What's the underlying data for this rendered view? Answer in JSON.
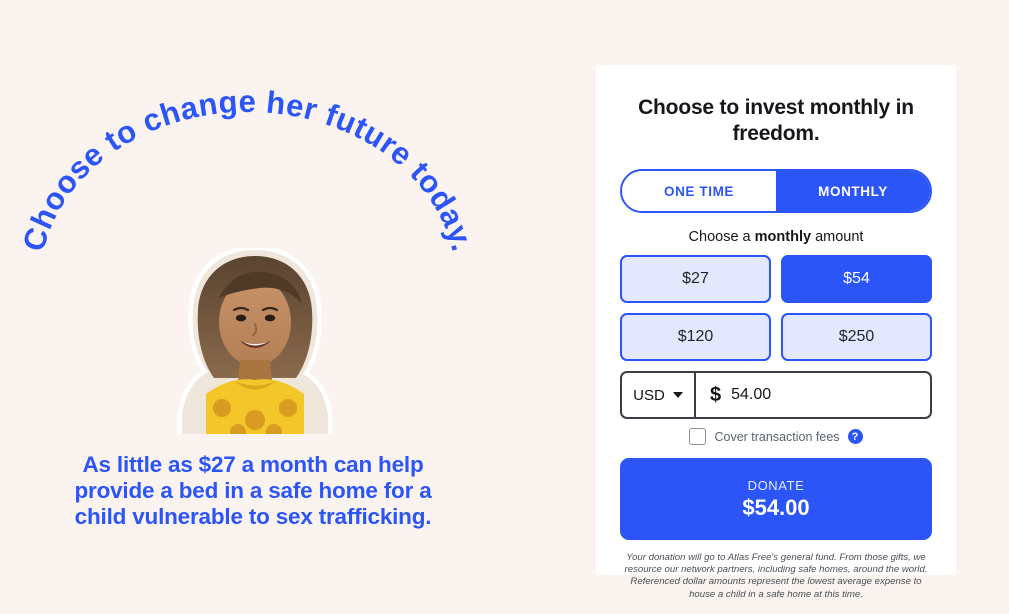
{
  "colors": {
    "page_background": "#faf3ef",
    "card_background": "#ffffff",
    "accent_blue": "#2b55f7",
    "light_blue": "#e3e8fd",
    "text_dark": "#15171a"
  },
  "left": {
    "arc_text": "Choose to change her future today.",
    "photo_alt": "smiling young girl in yellow patterned shirt",
    "headline": "As little as $27 a month can help provide a bed in a safe home for a child vulnerable to sex trafficking."
  },
  "card": {
    "title": "Choose to invest monthly in freedom.",
    "frequency_toggle": {
      "one_time_label": "ONE TIME",
      "monthly_label": "MONTHLY",
      "selected": "MONTHLY"
    },
    "amount_label_prefix": "Choose a ",
    "amount_label_bold": "monthly",
    "amount_label_suffix": " amount",
    "amount_options": [
      {
        "label": "$27",
        "selected": false
      },
      {
        "label": "$54",
        "selected": true
      },
      {
        "label": "$120",
        "selected": false
      },
      {
        "label": "$250",
        "selected": false
      }
    ],
    "currency": {
      "selected": "USD",
      "symbol": "$",
      "value": "54.00",
      "placeholder": "0.00"
    },
    "cover_fees": {
      "label": "Cover transaction fees",
      "checked": false,
      "help_icon_glyph": "?"
    },
    "donate_button": {
      "top_label": "DONATE",
      "amount_label": "$54.00"
    },
    "fine_print": "Your donation will go to Atlas Free's general fund. From those gifts, we resource our network partners, including safe homes, around the world. Referenced dollar amounts represent the lowest average expense to house a child in a safe home at this time."
  }
}
